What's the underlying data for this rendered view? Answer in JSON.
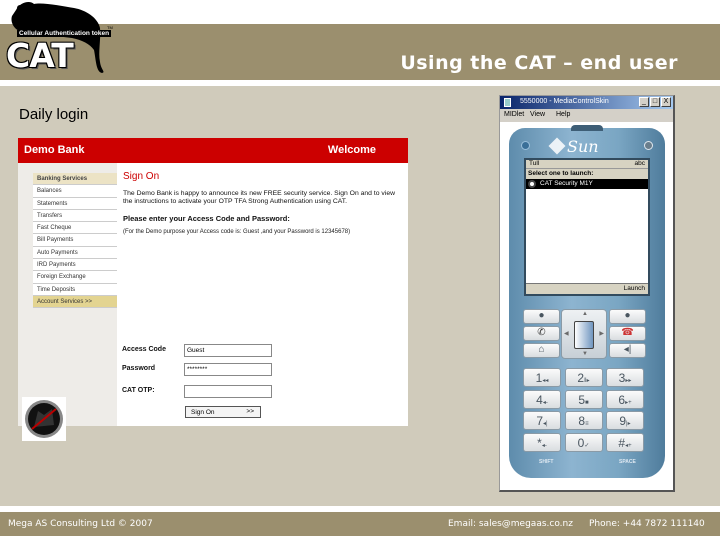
{
  "slide": {
    "title": "Using the CAT – end user",
    "section_label": "Daily login"
  },
  "logo": {
    "tagline": "Cellular Authentication token",
    "trademark": "TM",
    "word": "CAT"
  },
  "bank": {
    "name": "Demo Bank",
    "welcome": "Welcome",
    "menu": [
      {
        "label": "Banking Services",
        "type": "head"
      },
      {
        "label": "Balances",
        "type": "item"
      },
      {
        "label": "Statements",
        "type": "item"
      },
      {
        "label": "Transfers",
        "type": "item"
      },
      {
        "label": "Fast Cheque",
        "type": "item"
      },
      {
        "label": "Bill Payments",
        "type": "item"
      },
      {
        "label": "Auto Payments",
        "type": "item"
      },
      {
        "label": "IRD Payments",
        "type": "item"
      },
      {
        "label": "Foreign Exchange",
        "type": "item"
      },
      {
        "label": "Time Deposits",
        "type": "item"
      },
      {
        "label": "Account Services >>",
        "type": "active"
      }
    ],
    "sign_on_heading": "Sign On",
    "intro": "The Demo Bank is happy to announce its new FREE security service. Sign On and to view the instructions to activate your OTP TFA Strong Authentication using CAT.",
    "prompt": "Please enter your Access Code and Password:",
    "note": "(For the Demo purpose your Access code is: Guest ,and your Password is 12345678)",
    "form": {
      "access_code_label": "Access Code",
      "access_code_value": "Guest",
      "password_label": "Password",
      "password_value": "********",
      "otp_label": "CAT OTP:",
      "otp_value": "",
      "submit_label": "Sign On",
      "submit_arrow": ">>"
    }
  },
  "emulator": {
    "window_title": "5550000 - MediaControlSkin",
    "window_buttons": {
      "minimize": "_",
      "maximize": "□",
      "close": "X"
    },
    "menu": [
      "MIDlet",
      "View",
      "Help"
    ],
    "brand": "Sun",
    "screen": {
      "status_left": "Tull",
      "status_right": "abc",
      "header": "Select one to launch:",
      "items": [
        "CAT Security M1Y"
      ],
      "softkey": "Launch"
    },
    "keypad": [
      {
        "digit": "1",
        "sub": "◂◂"
      },
      {
        "digit": "2",
        "sub": "‖▸"
      },
      {
        "digit": "3",
        "sub": "▸▸"
      },
      {
        "digit": "4",
        "sub": "◂-"
      },
      {
        "digit": "5",
        "sub": "■"
      },
      {
        "digit": "6",
        "sub": "▸+"
      },
      {
        "digit": "7",
        "sub": "◂|"
      },
      {
        "digit": "8",
        "sub": "≡"
      },
      {
        "digit": "9",
        "sub": "|▸"
      },
      {
        "digit": "*",
        "sub": "◂-"
      },
      {
        "digit": "0",
        "sub": "✓"
      },
      {
        "digit": "#",
        "sub": "◂+"
      }
    ],
    "shift_label": "SHIFT",
    "space_label": "SPACE"
  },
  "footer": {
    "company": "Mega AS Consulting Ltd © 2007",
    "email": "Email: sales@megaas.co.nz",
    "phone": "Phone: +44 7872 111140"
  }
}
